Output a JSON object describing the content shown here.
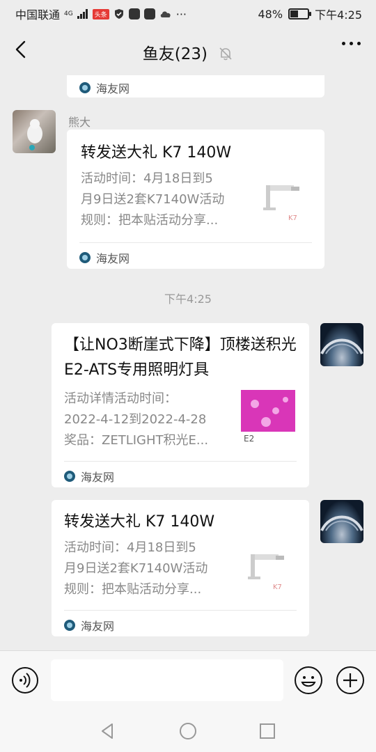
{
  "status_bar": {
    "carrier": "中国联通",
    "signal_label": "4G",
    "badge_text": "头条",
    "more_dots": "···",
    "battery_percent": "48%",
    "time": "下午4:25"
  },
  "header": {
    "title": "鱼友(23)",
    "back_icon": "chevron-left-icon",
    "mute_icon": "bell-off-icon",
    "more_icon": "more-dots-icon"
  },
  "messages": [
    {
      "partial_source": "海友网"
    },
    {
      "sender": "熊大",
      "title": "转发送大礼 K7 140W",
      "desc": "活动时间：4月18日到5\n月9日送2套K7140W活动\n规则：把本贴活动分享...",
      "source": "海友网"
    },
    {
      "timestamp": "下午4:25"
    },
    {
      "title": "【让NO3断崖式下降】顶楼送积光E2-ATS专用照明灯具",
      "desc": "活动详情活动时间：\n2022-4-12到2022-4-28\n奖品：ZETLIGHT积光E...",
      "source": "海友网",
      "thumb_label": "E2"
    },
    {
      "title": "转发送大礼 K7 140W",
      "desc": "活动时间：4月18日到5\n月9日送2套K7140W活动\n规则：把本贴活动分享...",
      "source": "海友网"
    }
  ],
  "input_bar": {
    "voice_icon": "voice-icon",
    "emoji_icon": "emoji-icon",
    "plus_icon": "plus-circle-icon",
    "value": ""
  },
  "nav_bar": {
    "back_icon": "nav-back-icon",
    "home_icon": "nav-home-icon",
    "recent_icon": "nav-recent-icon"
  },
  "colors": {
    "background": "#ededed",
    "card": "#ffffff",
    "source_icon": "#1f5b7a"
  }
}
